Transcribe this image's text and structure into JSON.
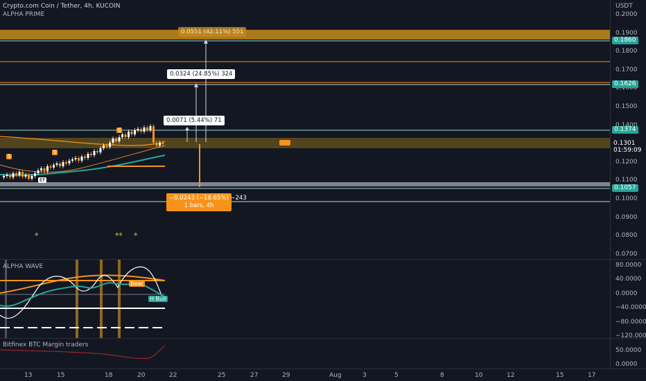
{
  "header": {
    "symbol_line": "Crypto.com Coin / Tether, 4h, KUCOIN",
    "indicator_name": "ALPHA PRIME"
  },
  "price_axis": {
    "currency": "USDT",
    "ticks": [
      "0.2000",
      "0.1900",
      "0.1800",
      "0.1700",
      "0.1600",
      "0.1500",
      "0.1400",
      "0.1300",
      "0.1200",
      "0.1100",
      "0.1000",
      "0.0900",
      "0.0800",
      "0.0700"
    ],
    "level_badges": [
      {
        "label": "0.1860",
        "color": "#26a69a"
      },
      {
        "label": "0.1626",
        "color": "#26a69a"
      },
      {
        "label": "0.1374",
        "color": "#26a69a"
      },
      {
        "label": "0.1057",
        "color": "#26a69a"
      }
    ],
    "current_price": "0.1301",
    "countdown": "01:59:09"
  },
  "measurements": {
    "target_1": "0.0071 (5.44%) 71",
    "target_2": "0.0324 (24.85%) 324",
    "target_3": "0.0551 (42.11%) 551",
    "stop_value": "−0.0243 (−18.65%) −243",
    "stop_bars": "1 bars, 4h"
  },
  "chart_markers": {
    "ef_label": "EF",
    "s_label": "S",
    "b_label": "B"
  },
  "oscillator": {
    "name": "ALPHA WAVE",
    "ticks": [
      "80.0000",
      "40.0000",
      "0.0000",
      "−40.0000",
      "−80.0000",
      "−120.0000"
    ],
    "bear_label": "Bear",
    "hbull_label": "H Bull"
  },
  "margin_pane": {
    "name": "Bitfinex BTC Margin traders",
    "ticks": [
      "50.0000",
      "0.0000"
    ]
  },
  "time_axis": {
    "labels": [
      "13",
      "15",
      "18",
      "20",
      "22",
      "25",
      "27",
      "29",
      "Aug",
      "3",
      "5",
      "8",
      "10",
      "12",
      "15",
      "17"
    ]
  },
  "colors": {
    "background": "#131722",
    "accent_orange": "#f7931a",
    "teal": "#26a69a",
    "grid": "#2a2e39"
  },
  "chart_data": {
    "type": "candlestick",
    "price_levels": [
      0.19,
      0.186,
      0.175,
      0.1626,
      0.1374,
      0.1301,
      0.1057,
      0.099
    ],
    "current_price": 0.1301,
    "ylim": [
      0.07,
      0.2
    ]
  }
}
